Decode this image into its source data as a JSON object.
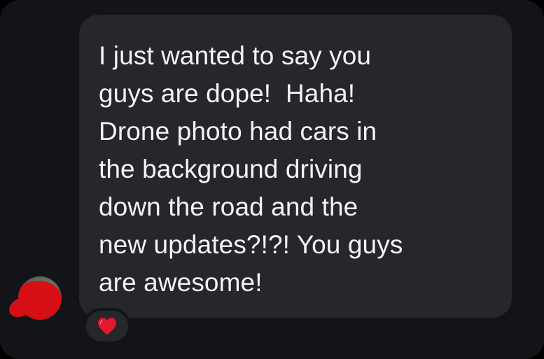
{
  "message": {
    "lines": [
      "I just wanted to say you",
      "guys are dope!  Haha!",
      "Drone photo had cars in",
      "the background driving",
      "down the road and the",
      "new updates?!?! You guys",
      "are awesome!"
    ]
  },
  "reaction": {
    "icon": "heart-icon",
    "color": "#e3172e"
  },
  "avatar": {
    "redaction_color": "#d60f14"
  },
  "colors": {
    "panel_background": "#121419",
    "bubble_background": "#26272b",
    "text": "#f4f4f6"
  }
}
